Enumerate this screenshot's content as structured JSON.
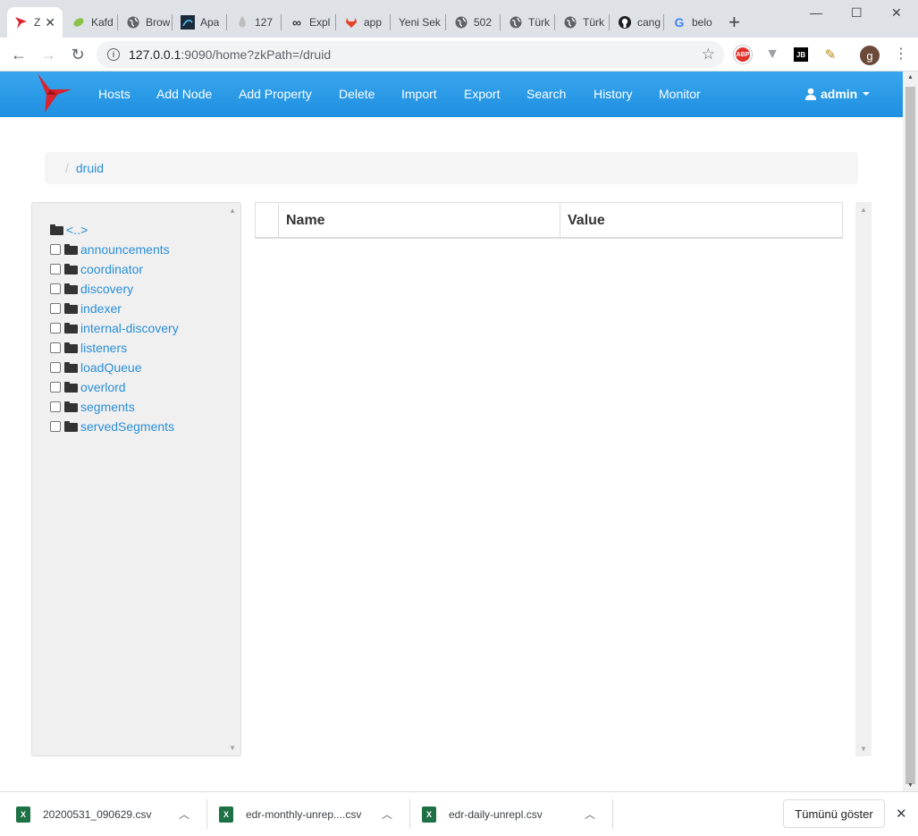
{
  "browser": {
    "tabs": [
      {
        "title": "Z",
        "icon": "zoonavigator-logo-icon"
      },
      {
        "title": "Kafd",
        "icon": "leaf-icon"
      },
      {
        "title": "Brow",
        "icon": "globe-icon"
      },
      {
        "title": "Apa",
        "icon": "apache-icon"
      },
      {
        "title": "127",
        "icon": "drop-icon"
      },
      {
        "title": "Expl",
        "icon": "infinity-icon"
      },
      {
        "title": "app",
        "icon": "gitlab-icon"
      },
      {
        "title": "Yeni Sek",
        "icon": ""
      },
      {
        "title": "502",
        "icon": "globe-icon"
      },
      {
        "title": "Türk",
        "icon": "globe-icon"
      },
      {
        "title": "Türk",
        "icon": "globe-icon"
      },
      {
        "title": "cang",
        "icon": "github-icon"
      },
      {
        "title": "belo",
        "icon": "google-icon"
      }
    ],
    "url_host": "127.0.0.1",
    "url_rest": ":9090/home?zkPath=/druid",
    "profile_initial": "g",
    "ext_abp": "ABP",
    "ext_jb": "JB"
  },
  "navbar": {
    "links": [
      "Hosts",
      "Add Node",
      "Add Property",
      "Delete",
      "Import",
      "Export",
      "Search",
      "History",
      "Monitor"
    ],
    "user": "admin",
    "brand_color": "#2196e8"
  },
  "breadcrumb": {
    "separator": "/",
    "current": "druid"
  },
  "tree": {
    "parent": "<..>",
    "nodes": [
      "announcements",
      "coordinator",
      "discovery",
      "indexer",
      "internal-discovery",
      "listeners",
      "loadQueue",
      "overlord",
      "segments",
      "servedSegments"
    ]
  },
  "table": {
    "headers": [
      "Name",
      "Value"
    ]
  },
  "downloads": {
    "items": [
      "20200531_090629.csv",
      "edr-monthly-unrep....csv",
      "edr-daily-unrepl.csv"
    ],
    "show_all": "Tümünü göster"
  }
}
